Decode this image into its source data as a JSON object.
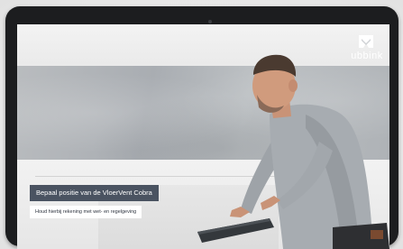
{
  "brand": {
    "logo_text": "ubbink",
    "logo_icon": "ubbink-logo-icon"
  },
  "video": {
    "caption_title": "Bepaal positie van de VloerVent Cobra",
    "caption_subtitle": "Houd hierbij rekening met wet- en regelgeving"
  },
  "colors": {
    "caption_bg": "#4a5361",
    "tablet_frame": "#1c1d1f"
  }
}
